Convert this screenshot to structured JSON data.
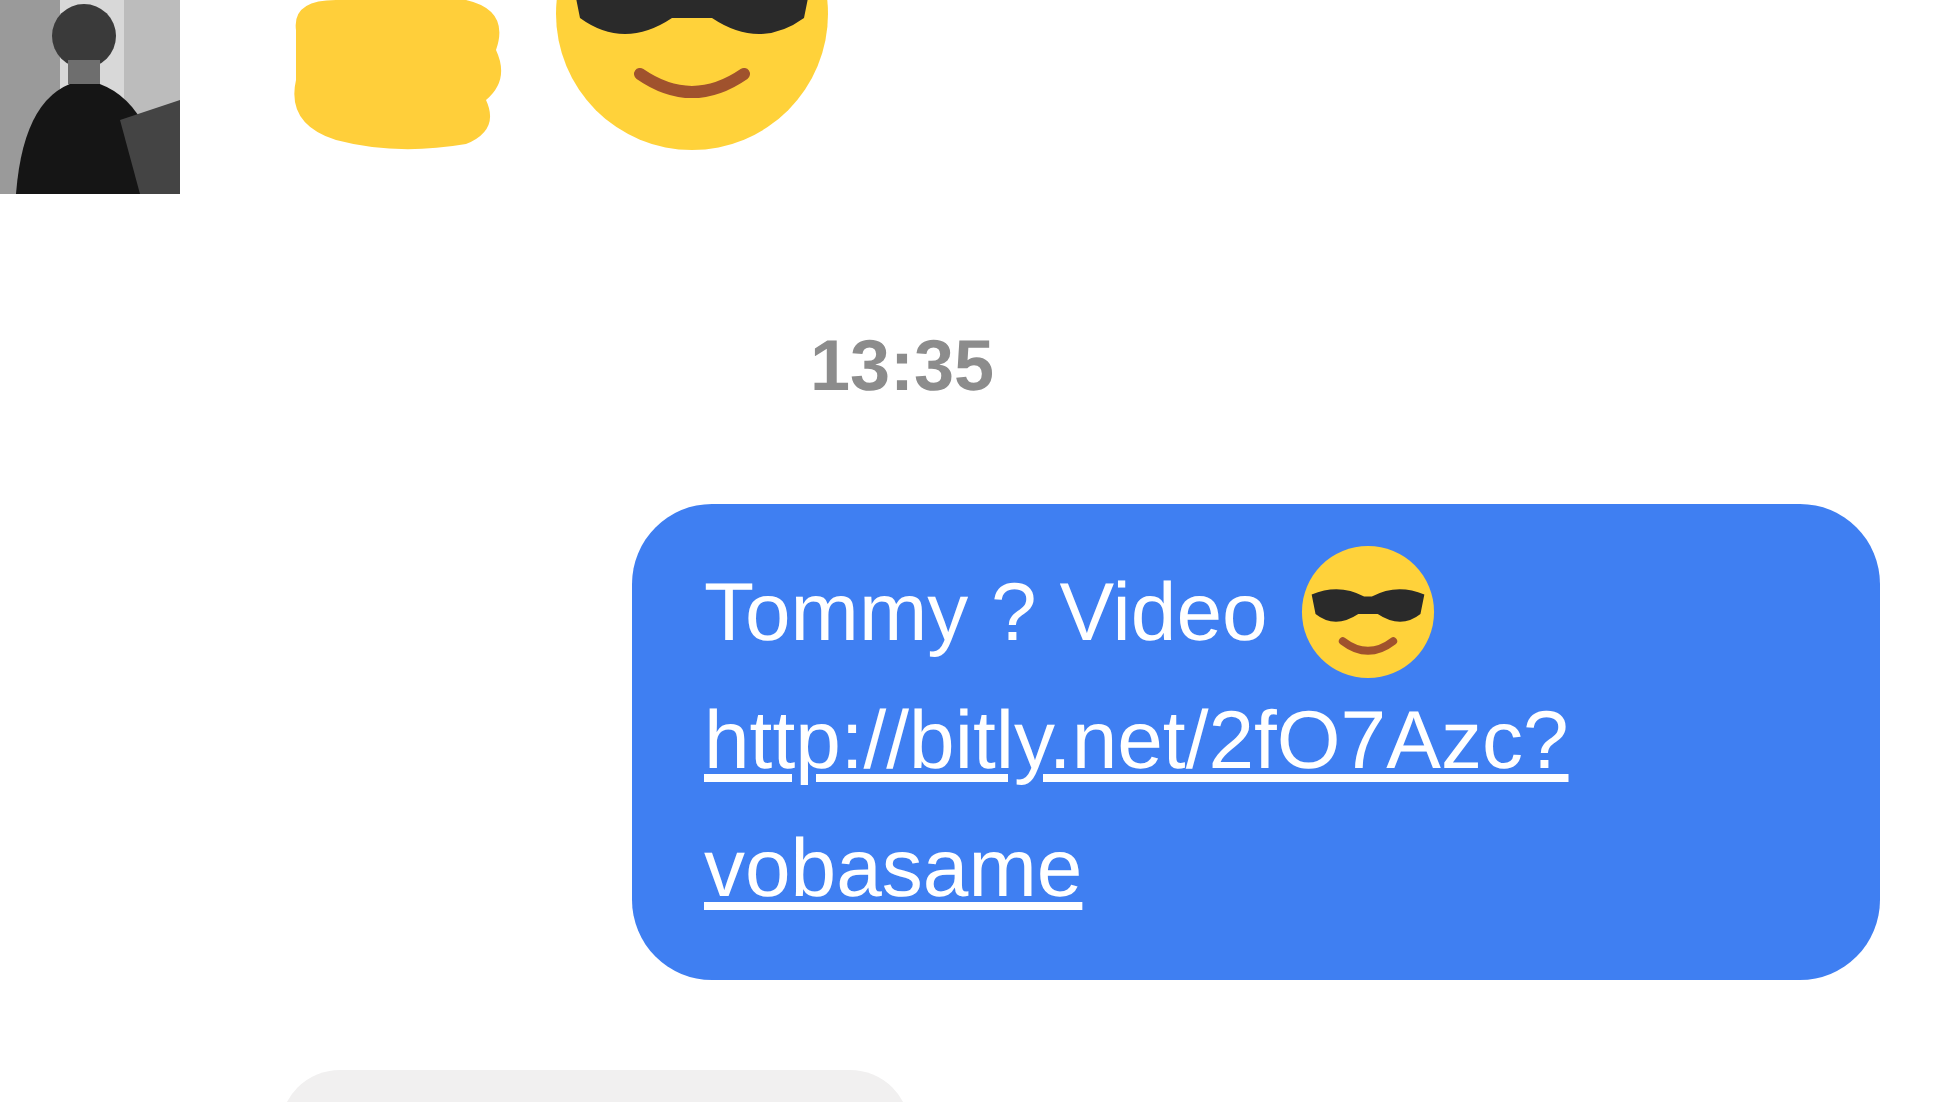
{
  "top_message": {
    "kind": "incoming"
  },
  "timestamp": "13:35",
  "messages": [
    {
      "kind": "outgoing",
      "text": "Tommy ? Video",
      "link": "http://bitly.net/2fO7Azc?vobasame"
    },
    {
      "kind": "incoming"
    }
  ]
}
